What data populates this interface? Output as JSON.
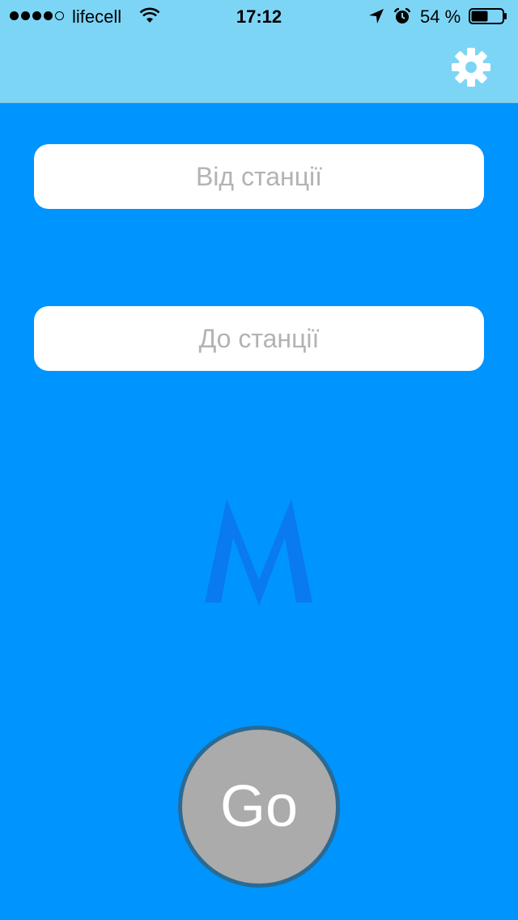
{
  "status_bar": {
    "carrier": "lifecell",
    "signal_bars_filled": 4,
    "signal_bars_total": 5,
    "time": "17:12",
    "battery_percent": "54 %",
    "battery_level": 0.54
  },
  "header": {
    "settings_icon": "gear-icon"
  },
  "form": {
    "from_placeholder": "Від станції",
    "from_value": "",
    "to_placeholder": "До станції",
    "to_value": ""
  },
  "logo": {
    "icon": "metro-logo",
    "color": "#0a7af0"
  },
  "go_button": {
    "label": "Go"
  },
  "colors": {
    "background": "#0094ff",
    "header": "#7dd5f6",
    "go_button_fill": "#ababab",
    "go_button_border": "#2a6a93"
  }
}
